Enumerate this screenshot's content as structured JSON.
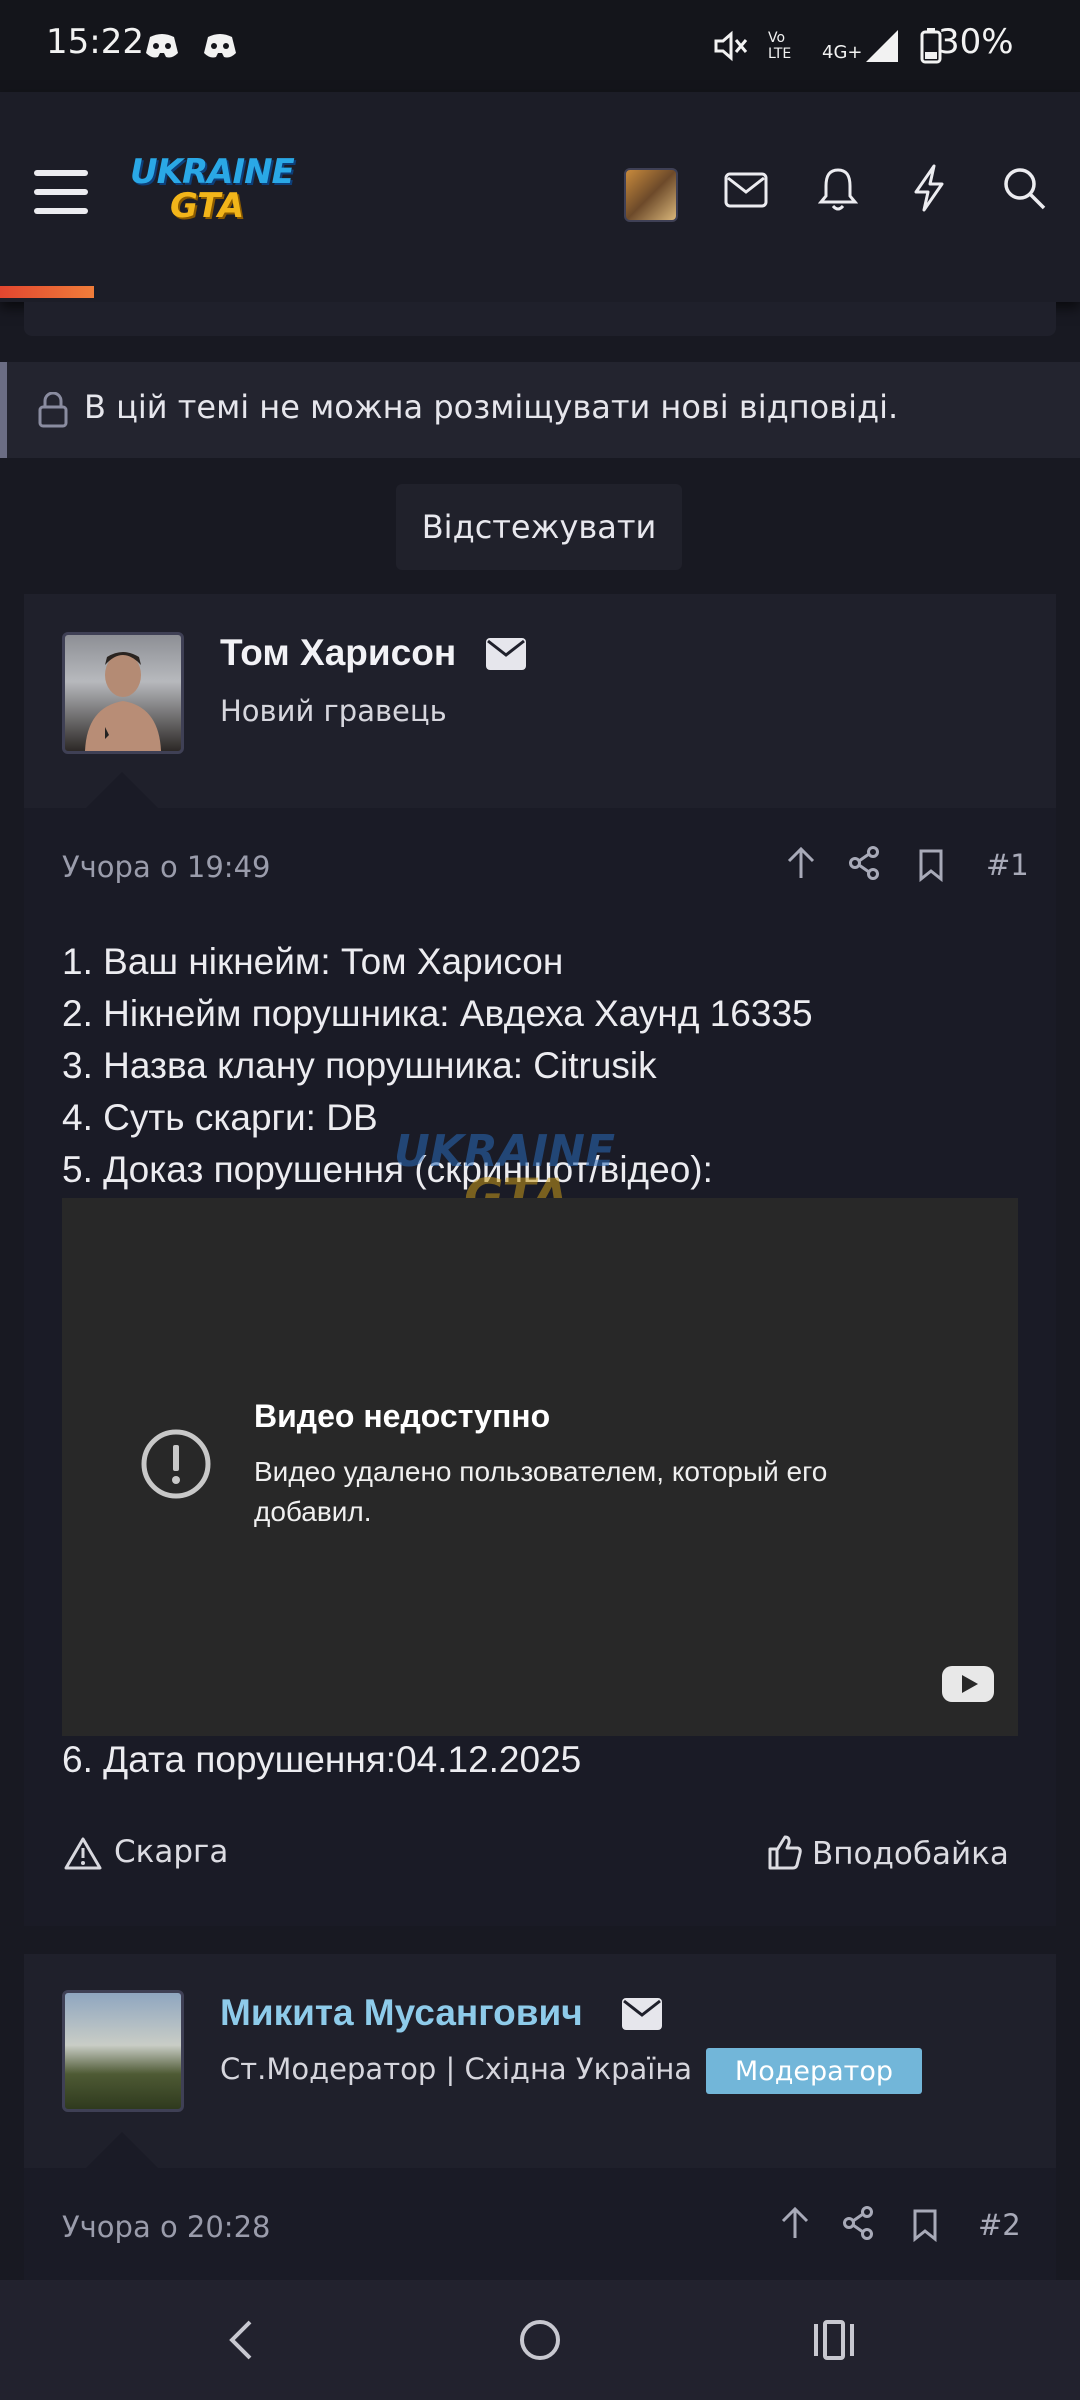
{
  "status_bar": {
    "time": "15:22",
    "battery": "30%",
    "network": "4G+",
    "volte": "Vo LTE",
    "icons": [
      "discord-icon",
      "discord-icon",
      "mute-icon",
      "volte-icon",
      "signal-icon",
      "battery-icon"
    ]
  },
  "header": {
    "logo_line1": "UKRAINE",
    "logo_line2": "GTA",
    "icons": [
      "menu-icon",
      "avatar",
      "mail-icon",
      "bell-icon",
      "lightning-icon",
      "search-icon"
    ]
  },
  "thread": {
    "locked_notice": "В цій темі не можна розміщувати нові відповіді.",
    "follow_label": "Відстежувати"
  },
  "post1": {
    "author": "Том Харисон",
    "author_title": "Новий гравець",
    "time": "Учора о 19:49",
    "number": "#1",
    "lines": [
      "1. Ваш нікнейм: Том Харисон",
      "2. Нікнейм порушника: Авдеха Хаунд 16335",
      "3. Назва клану порушника: Citrusik",
      "4. Суть скарги: DB",
      "5. Доказ порушення (скриншот/відео):"
    ],
    "video_title": "Видео недоступно",
    "video_message_line1": "Видео удалено пользователем, который его",
    "video_message_line2": "добавил.",
    "last_line": "6. Дата порушення:04.12.2025",
    "report_label": "Скарга",
    "like_label": "Вподобайка"
  },
  "post2": {
    "author": "Микита Мусангович",
    "author_title": "Ст.Модератор | Східна Україна",
    "badge": "Модератор",
    "time": "Учора о 20:28",
    "number": "#2"
  },
  "colors": {
    "moderator_name": "#8ecbea",
    "badge_bg": "#72b6d9",
    "accent": "#e2462f"
  }
}
